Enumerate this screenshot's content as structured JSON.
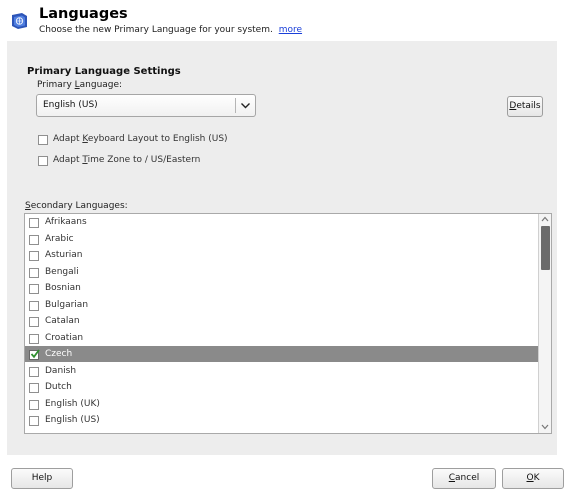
{
  "header": {
    "title": "Languages",
    "subtitle": "Choose the new Primary Language for your system.",
    "more_link": "more",
    "icon": "language-flag-icon"
  },
  "primary_settings": {
    "section_title": "Primary Language Settings",
    "primary_label_prefix": "Primary ",
    "primary_label_mnemonic": "L",
    "primary_label_suffix": "anguage:",
    "selected_language": "English (US)",
    "details_mnemonic": "D",
    "details_suffix": "etails",
    "adapt_keyboard": {
      "prefix": "Adapt ",
      "mnemonic": "K",
      "suffix": "eyboard Layout to English (US)",
      "checked": false
    },
    "adapt_timezone": {
      "prefix": "Adapt ",
      "mnemonic": "T",
      "suffix": "ime Zone to  / US/Eastern",
      "checked": false
    }
  },
  "secondary": {
    "label_mnemonic": "S",
    "label_suffix": "econdary Languages:",
    "items": [
      {
        "label": "Afrikaans",
        "checked": false,
        "selected": false
      },
      {
        "label": "Arabic",
        "checked": false,
        "selected": false
      },
      {
        "label": "Asturian",
        "checked": false,
        "selected": false
      },
      {
        "label": "Bengali",
        "checked": false,
        "selected": false
      },
      {
        "label": "Bosnian",
        "checked": false,
        "selected": false
      },
      {
        "label": "Bulgarian",
        "checked": false,
        "selected": false
      },
      {
        "label": "Catalan",
        "checked": false,
        "selected": false
      },
      {
        "label": "Croatian",
        "checked": false,
        "selected": false
      },
      {
        "label": "Czech",
        "checked": true,
        "selected": true
      },
      {
        "label": "Danish",
        "checked": false,
        "selected": false
      },
      {
        "label": "Dutch",
        "checked": false,
        "selected": false
      },
      {
        "label": "English (UK)",
        "checked": false,
        "selected": false
      },
      {
        "label": "English (US)",
        "checked": false,
        "selected": false
      }
    ]
  },
  "footer": {
    "help_label": "Help",
    "cancel_mnemonic": "C",
    "cancel_suffix": "ancel",
    "ok_mnemonic": "O",
    "ok_suffix": "K"
  },
  "colors": {
    "accent_selected": "#8a8a8a",
    "link": "#1a3fd9",
    "panel_bg": "#ededed"
  }
}
